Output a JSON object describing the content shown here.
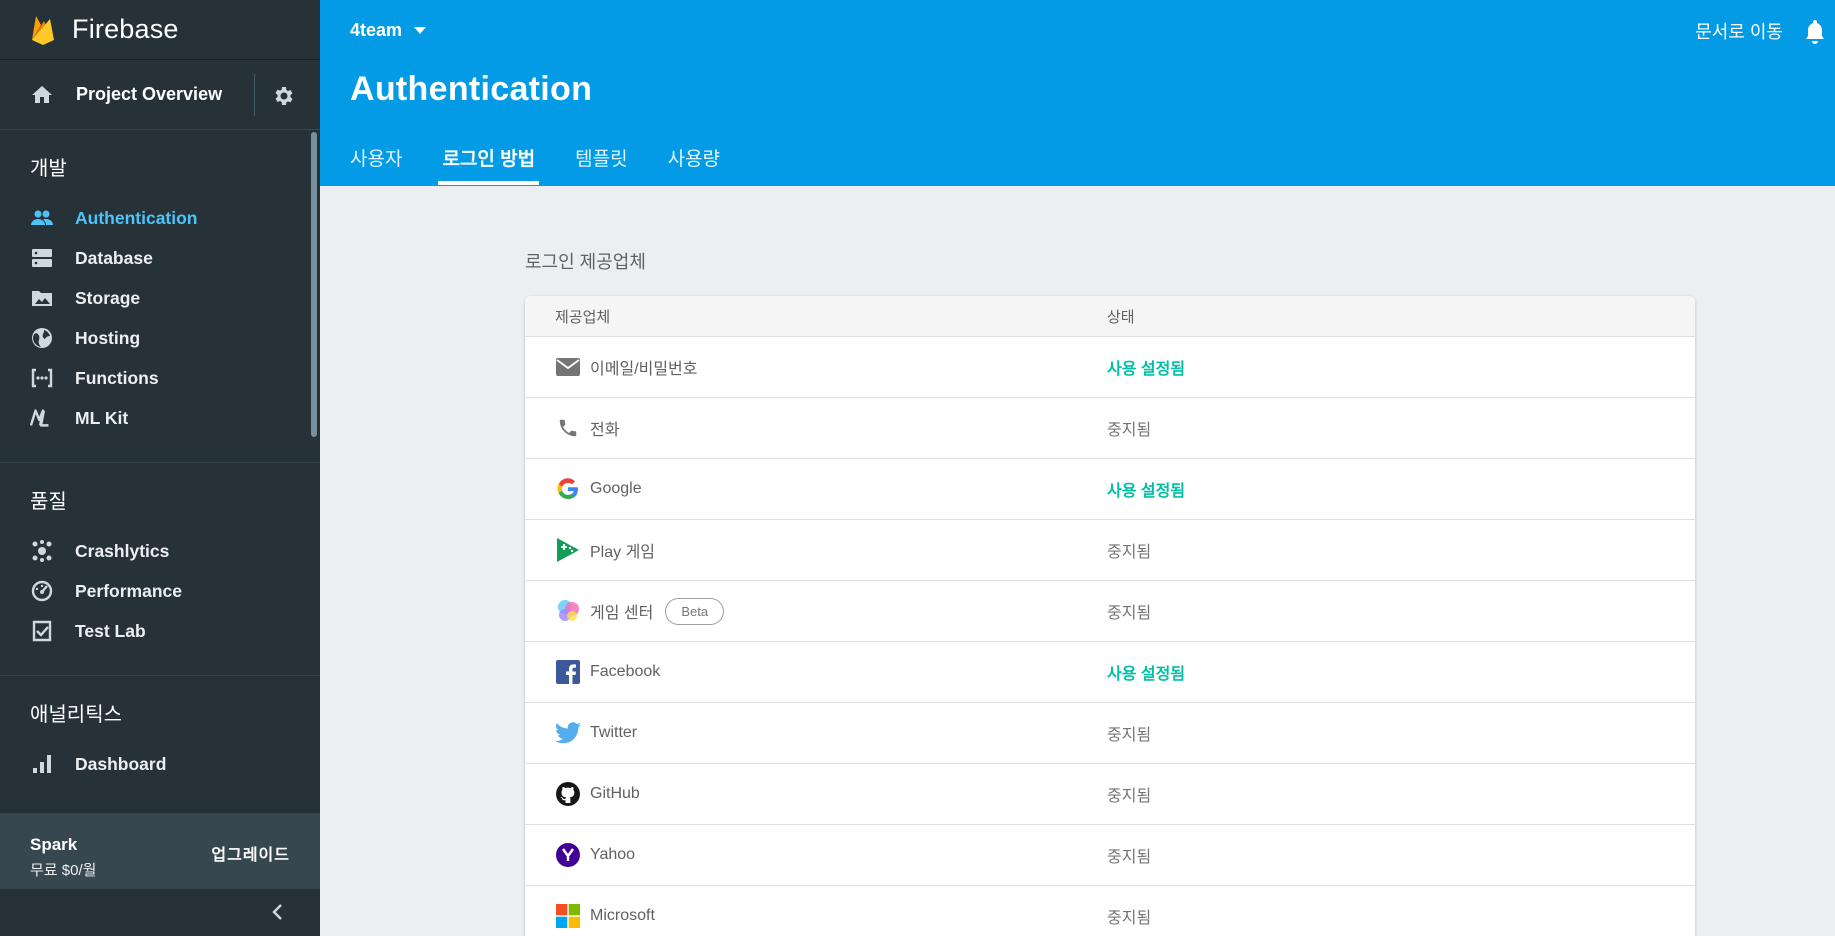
{
  "sidebar": {
    "brand": "Firebase",
    "overview": "Project Overview",
    "sections": [
      {
        "title": "개발",
        "items": [
          {
            "label": "Authentication",
            "icon": "people-icon"
          },
          {
            "label": "Database",
            "icon": "database-icon"
          },
          {
            "label": "Storage",
            "icon": "image-icon"
          },
          {
            "label": "Hosting",
            "icon": "globe-icon"
          },
          {
            "label": "Functions",
            "icon": "functions-icon"
          },
          {
            "label": "ML Kit",
            "icon": "ml-kit-icon"
          }
        ]
      },
      {
        "title": "품질",
        "items": [
          {
            "label": "Crashlytics",
            "icon": "crashlytics-icon"
          },
          {
            "label": "Performance",
            "icon": "speedometer-icon"
          },
          {
            "label": "Test Lab",
            "icon": "checklist-icon"
          }
        ]
      },
      {
        "title": "애널리틱스",
        "items": [
          {
            "label": "Dashboard",
            "icon": "bar-chart-icon"
          }
        ]
      }
    ],
    "footer": {
      "plan": "Spark",
      "price": "무료 $0/월",
      "upgrade": "업그레이드"
    }
  },
  "header": {
    "project": "4team",
    "docs_link": "문서로 이동",
    "title": "Authentication",
    "tabs": [
      "사용자",
      "로그인 방법",
      "템플릿",
      "사용량"
    ]
  },
  "main": {
    "section_label": "로그인 제공업체",
    "columns": {
      "provider": "제공업체",
      "status": "상태"
    },
    "providers": [
      {
        "name": "이메일/비밀번호",
        "status": "사용 설정됨",
        "icon": "mail-icon"
      },
      {
        "name": "전화",
        "status": "중지됨",
        "icon": "phone-icon"
      },
      {
        "name": "Google",
        "status": "사용 설정됨",
        "icon": "google-icon"
      },
      {
        "name": "Play 게임",
        "status": "중지됨",
        "icon": "play-games-icon"
      },
      {
        "name": "게임 센터",
        "status": "중지됨",
        "icon": "game-center-icon",
        "badge": "Beta"
      },
      {
        "name": "Facebook",
        "status": "사용 설정됨",
        "icon": "facebook-icon"
      },
      {
        "name": "Twitter",
        "status": "중지됨",
        "icon": "twitter-icon"
      },
      {
        "name": "GitHub",
        "status": "중지됨",
        "icon": "github-icon"
      },
      {
        "name": "Yahoo",
        "status": "중지됨",
        "icon": "yahoo-icon"
      },
      {
        "name": "Microsoft",
        "status": "중지됨",
        "icon": "microsoft-icon"
      }
    ]
  },
  "colors": {
    "header_bg": "#039be5",
    "sidebar_bg": "#263238",
    "active_nav": "#4fc3f7",
    "enabled_status": "#00bfa5",
    "page_bg": "#eceff1"
  }
}
